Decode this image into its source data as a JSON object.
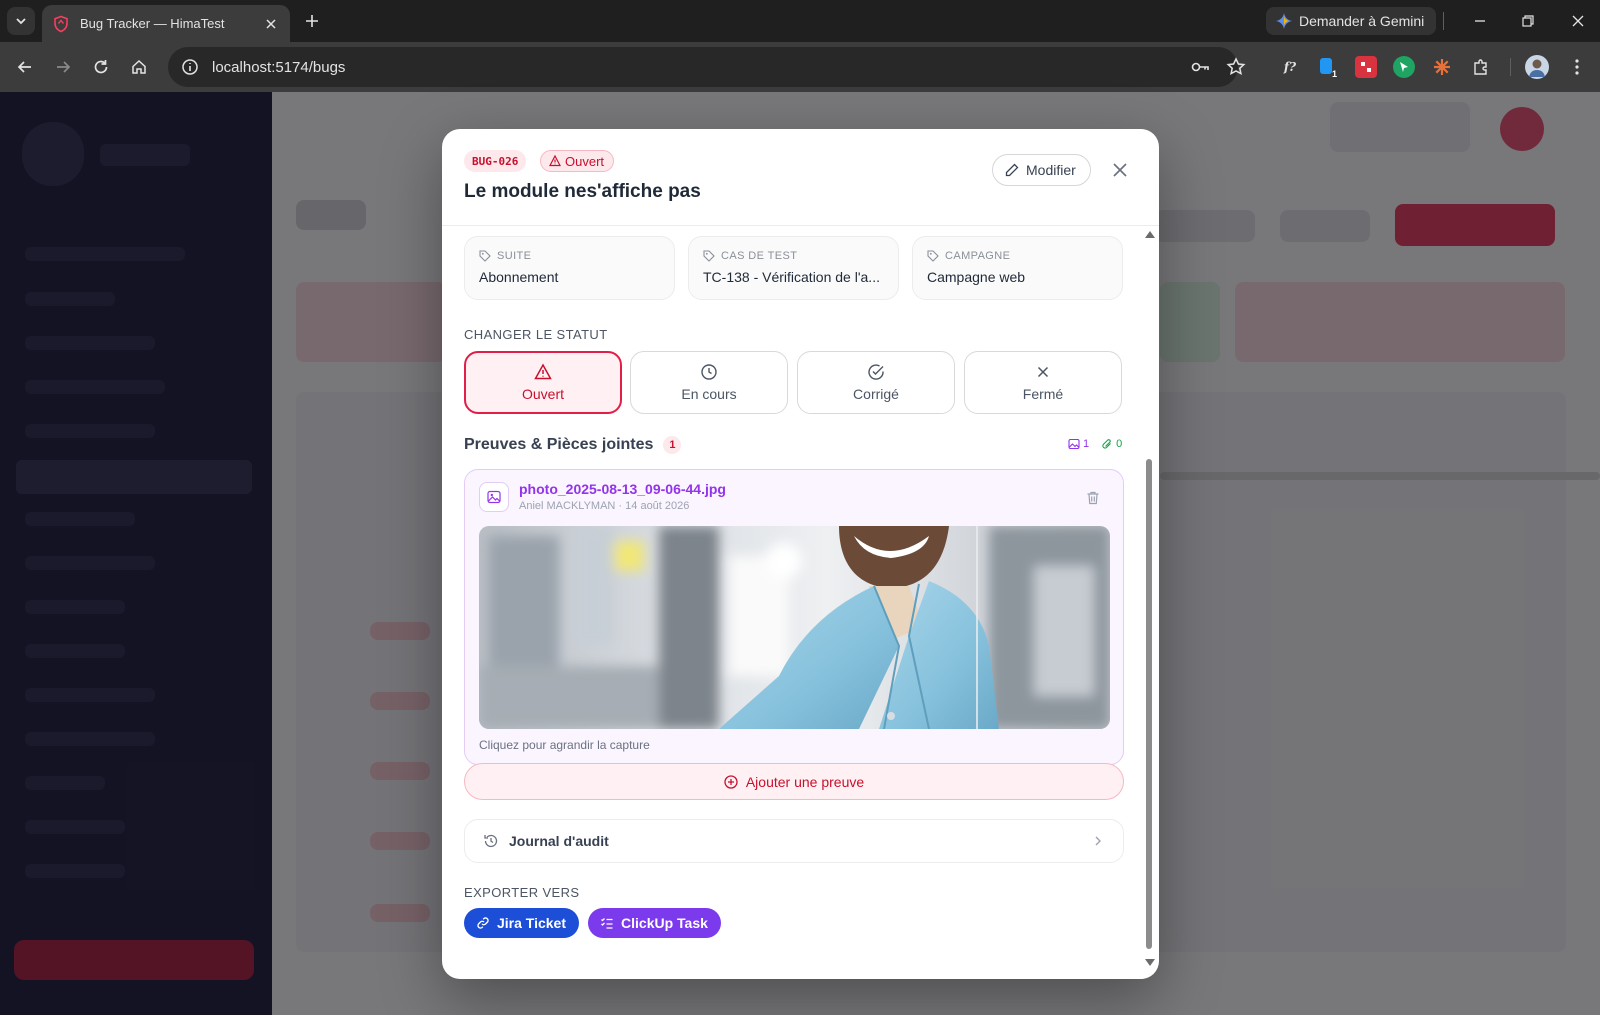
{
  "browser": {
    "tab_title": "Bug Tracker — HimaTest",
    "url": "localhost:5174/bugs",
    "gemini_label": "Demander à Gemini",
    "extension_badge": "1"
  },
  "modal": {
    "bug_id": "BUG-026",
    "status_badge": "Ouvert",
    "title": "Le module nes'affiche pas",
    "edit_label": "Modifier",
    "meta": [
      {
        "label": "SUITE",
        "value": "Abonnement"
      },
      {
        "label": "CAS DE TEST",
        "value": "TC-138 - Vérification de l'a..."
      },
      {
        "label": "CAMPAGNE",
        "value": "Campagne web"
      }
    ],
    "change_status_label": "CHANGER LE STATUT",
    "statuses": [
      {
        "label": "Ouvert",
        "icon": "warning-triangle-icon",
        "active": true
      },
      {
        "label": "En cours",
        "icon": "clock-icon",
        "active": false
      },
      {
        "label": "Corrigé",
        "icon": "check-circle-icon",
        "active": false
      },
      {
        "label": "Fermé",
        "icon": "x-icon",
        "active": false
      }
    ],
    "attachments": {
      "title": "Preuves & Pièces jointes",
      "count": "1",
      "image_count": "1",
      "file_count": "0",
      "file_name": "photo_2025-08-13_09-06-44.jpg",
      "file_meta": "Aniel MACKLYMAN · 14 août 2026",
      "caption": "Cliquez pour agrandir la capture"
    },
    "add_proof_label": "Ajouter une preuve",
    "audit_label": "Journal d'audit",
    "export_label": "EXPORTER VERS",
    "export_buttons": [
      {
        "label": "Jira Ticket",
        "color": "#1d4ed8"
      },
      {
        "label": "ClickUp Task",
        "color": "#7c3aed"
      }
    ]
  },
  "colors": {
    "accent": "#e11d48",
    "purple": "#9333ea",
    "sidebar": "#1a1838"
  }
}
